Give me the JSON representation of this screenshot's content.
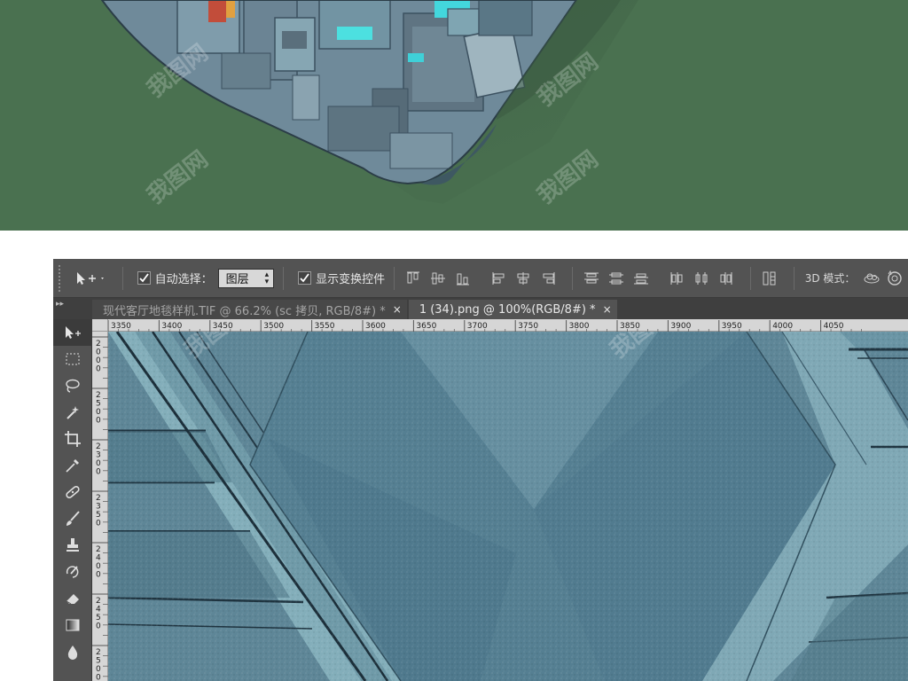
{
  "options_bar": {
    "auto_select_label": "自动选择：",
    "auto_select_checked": true,
    "auto_select_target": "图层",
    "show_transform_label": "显示变换控件",
    "show_transform_checked": true,
    "mode_3d_label": "3D 模式："
  },
  "tabs": [
    {
      "title": "现代客厅地毯样机.TIF @ 66.2% (sc 拷贝, RGB/8#) *",
      "close": "×",
      "active": false
    },
    {
      "title": "1 (34).png @ 100%(RGB/8#) *",
      "close": "×",
      "active": true
    }
  ],
  "tab_gutter": "▸▸",
  "ruler": {
    "horizontal_labels": [
      "3350",
      "3400",
      "3450",
      "3500",
      "3550",
      "3600",
      "3650",
      "3700",
      "3750",
      "3800",
      "3850",
      "3900",
      "3950",
      "4000",
      "4050"
    ],
    "vertical_labels": [
      "2000",
      "2500",
      "2300",
      "2350",
      "2400",
      "2450",
      "2500"
    ]
  },
  "toolbox": {
    "tools": [
      "move-tool",
      "marquee-tool",
      "lasso-tool",
      "magic-wand-tool",
      "crop-tool",
      "eyedropper-tool",
      "healing-brush-tool",
      "brush-tool",
      "clone-stamp-tool",
      "history-brush-tool",
      "eraser-tool",
      "gradient-tool",
      "blur-tool"
    ]
  },
  "watermark": "我图网",
  "colors": {
    "banner_bg": "#4a7150",
    "ps_panel": "#535353",
    "tab_bar": "#3f3f3f",
    "canvas_base": "#5e8697",
    "ruler_bg": "#d6d6d6"
  }
}
